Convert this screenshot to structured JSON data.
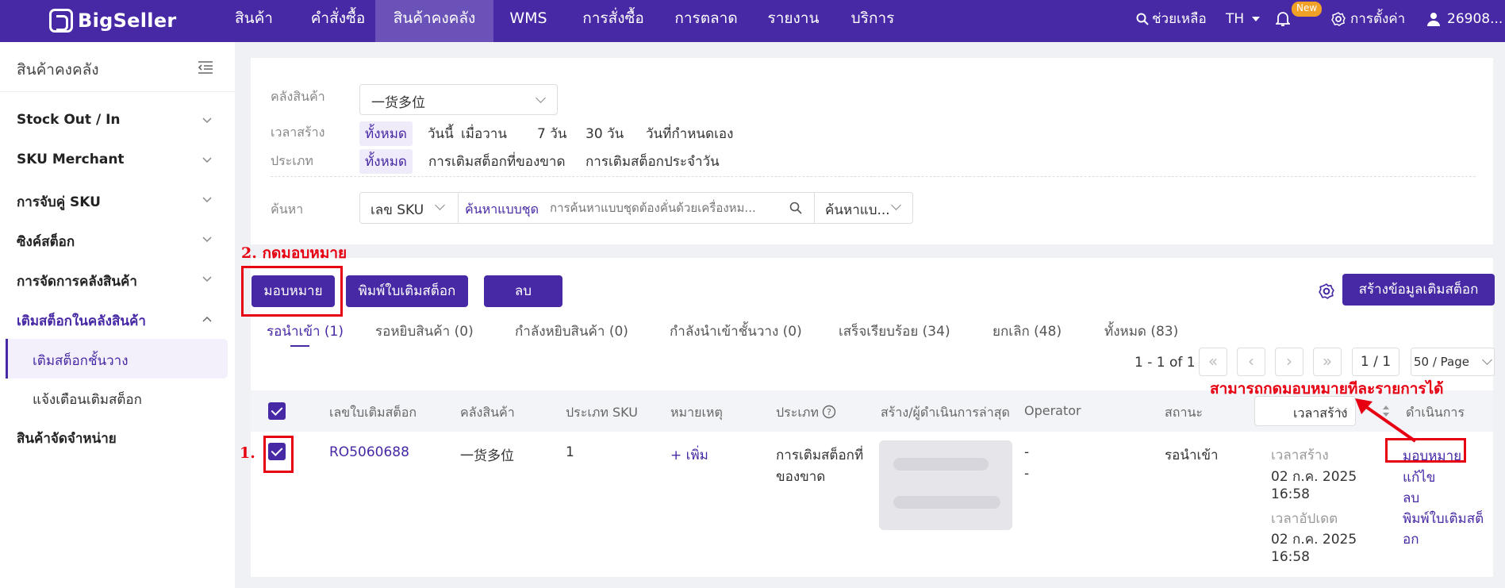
{
  "brand": {
    "name": "BigSeller"
  },
  "nav": [
    "สินค้า",
    "คำสั่งซื้อ",
    "สินค้าคงคลัง",
    "WMS",
    "การสั่งซื้อ",
    "การตลาด",
    "รายงาน",
    "บริการ"
  ],
  "topright": {
    "help": "ช่วยเหลือ",
    "lang": "TH",
    "badge": "New",
    "settings": "การตั้งค่า",
    "user": "26908..."
  },
  "sidebar": {
    "title": "สินค้าคงคลัง",
    "items": [
      "Stock Out / In",
      "SKU Merchant",
      "การจับคู่ SKU",
      "ซิงค์สต็อก",
      "การจัดการคลังสินค้า",
      "เติมสต็อกในคลังสินค้า"
    ],
    "subitems": [
      "เติมสต็อกชั้นวาง",
      "แจ้งเตือนเติมสต็อก"
    ],
    "last": "สินค้าจัดจำหน่าย"
  },
  "filters": {
    "warehouse_label": "คลังสินค้า",
    "warehouse_value": "一货多位",
    "created_label": "เวลาสร้าง",
    "created_options": [
      "ทั้งหมด",
      "วันนี้",
      "เมื่อวาน",
      "7 วัน",
      "30 วัน",
      "วันที่กำหนดเอง"
    ],
    "type_label": "ประเภท",
    "type_options": [
      "ทั้งหมด",
      "การเติมสต็อกที่ของขาด",
      "การเติมสต็อกประจำวัน"
    ],
    "search_label": "ค้นหา",
    "search_field": "เลข SKU",
    "search_mode": "ค้นหาแบบชุด",
    "search_placeholder": "การค้นหาแบบชุดต้องคั่นด้วยเครื่องหม...",
    "search_type": "ค้นหาแบ..."
  },
  "actions": {
    "assign": "มอบหมาย",
    "print": "พิมพ์ใบเติมสต็อก",
    "delete": "ลบ",
    "create": "สร้างข้อมูลเติมสต็อก"
  },
  "tabs": [
    "รอนำเข้า (1)",
    "รอหยิบสินค้า (0)",
    "กำลังหยิบสินค้า (0)",
    "กำลังนำเข้าชั้นวาง (0)",
    "เสร็จเรียบร้อย (34)",
    "ยกเลิก (48)",
    "ทั้งหมด (83)"
  ],
  "pagination": {
    "range": "1 - 1 of 1",
    "page": "1 / 1",
    "per_page": "50 / Page"
  },
  "columns": [
    "เลขใบเติมสต็อก",
    "คลังสินค้า",
    "ประเภท SKU",
    "หมายเหตุ",
    "ประเภท",
    "สร้าง/ผู้ดำเนินการล่าสุด",
    "Operator",
    "สถานะ",
    "เวลาสร้าง",
    "ดำเนินการ"
  ],
  "row": {
    "number": "RO5060688",
    "warehouse": "一货多位",
    "sku_type": "1",
    "note_add": "+ เพิ่ม",
    "type_line1": "การเติมสต็อกที่",
    "type_line2": "ของขาด",
    "operator1": "-",
    "operator2": "-",
    "status": "รอนำเข้า",
    "created_label": "เวลาสร้าง",
    "created_date": "02 ก.ค. 2025",
    "created_time": "16:58",
    "updated_label": "เวลาอัปเดต",
    "updated_date": "02 ก.ค. 2025",
    "updated_time": "16:58",
    "op_assign": "มอบหมาย",
    "op_edit": "แก้ไข",
    "op_delete": "ลบ",
    "op_print1": "พิมพ์ใบเติมสต็",
    "op_print2": "อก"
  },
  "annotations": {
    "step1": "1.",
    "step2": "2. กดมอบหมาย",
    "note": "สามารถกดมอบหมายทีละรายการได้"
  },
  "colors": {
    "brand": "#4728a5",
    "annotation": "#e60012"
  }
}
